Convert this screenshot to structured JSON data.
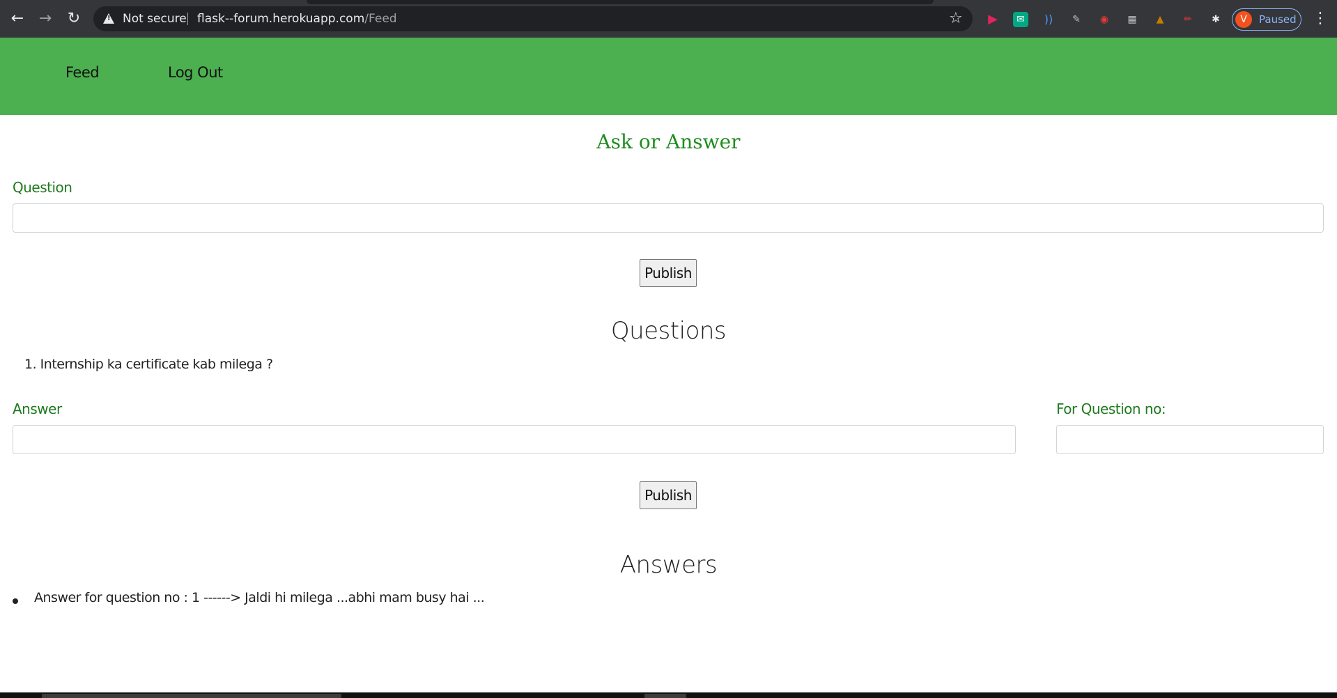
{
  "browser": {
    "security_label": "Not secure",
    "url_host": "flask--forum.herokuapp.com",
    "url_path": "/Feed",
    "profile_initial": "V",
    "profile_status": "Paused"
  },
  "nav": {
    "feed": "Feed",
    "logout": "Log Out",
    "bg_color": "#4caf50"
  },
  "ask_section": {
    "heading": "Ask or Answer",
    "question_label": "Question",
    "question_value": "",
    "publish_label": "Publish"
  },
  "questions_section": {
    "title": "Questions",
    "items": [
      "1. Internship ka certificate kab milega ?"
    ]
  },
  "answer_form": {
    "answer_label": "Answer",
    "answer_value": "",
    "qno_label": "For Question no:",
    "qno_value": "",
    "publish_label": "Publish"
  },
  "answers_section": {
    "title": "Answers",
    "items": [
      "Answer for question no : 1 ------> Jaldi hi milega ...abhi mam busy hai ..."
    ]
  }
}
